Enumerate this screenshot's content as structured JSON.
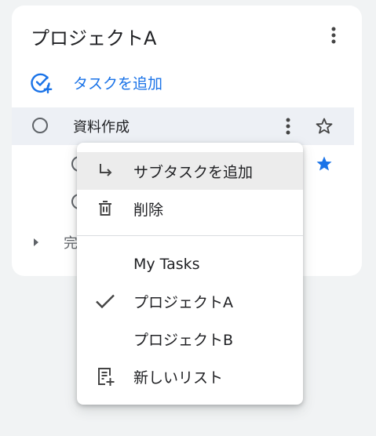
{
  "list": {
    "title": "プロジェクトA",
    "add_task_label": "タスクを追加",
    "completed_label": "完"
  },
  "tasks": [
    {
      "title": "資料作成",
      "starred": false
    },
    {
      "title": "",
      "starred": true
    },
    {
      "title": "",
      "starred": false
    }
  ],
  "context_menu": {
    "items": [
      {
        "label": "サブタスクを追加",
        "icon": "subdirectory-arrow-icon"
      },
      {
        "label": "削除",
        "icon": "trash-icon"
      }
    ],
    "lists": [
      {
        "label": "My Tasks",
        "selected": false
      },
      {
        "label": "プロジェクトA",
        "selected": true
      },
      {
        "label": "プロジェクトB",
        "selected": false
      }
    ],
    "new_list_label": "新しいリスト"
  },
  "colors": {
    "accent": "#1a73e8",
    "star_filled": "#1a73e8",
    "row_highlight": "#edf0f5",
    "menu_highlight": "#ececec"
  }
}
